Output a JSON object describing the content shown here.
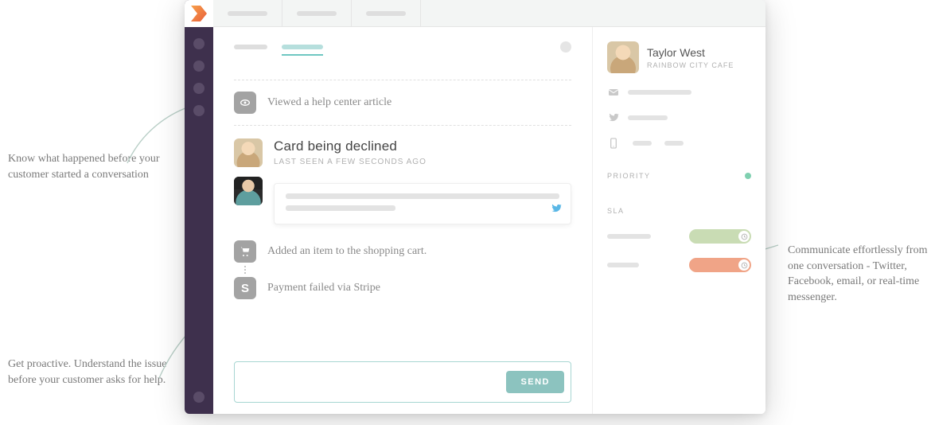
{
  "annotations": {
    "left1": "Know what happened before your customer started a conversation",
    "left2": "Get proactive. Understand the issue before your customer asks for help.",
    "right1": "Communicate effortlessly from one conversation - Twitter, Facebook, email, or real-time messenger."
  },
  "timeline": {
    "viewed_article": "Viewed a help center article",
    "added_cart": "Added an item to the shopping cart.",
    "payment_failed": "Payment failed via Stripe"
  },
  "conversation": {
    "title": "Card being declined",
    "subtitle": "LAST SEEN A FEW SECONDS AGO"
  },
  "reply": {
    "send_label": "SEND"
  },
  "customer": {
    "name": "Taylor West",
    "org": "RAINBOW CITY CAFE",
    "priority_label": "PRIORITY",
    "sla_label": "SLA"
  }
}
